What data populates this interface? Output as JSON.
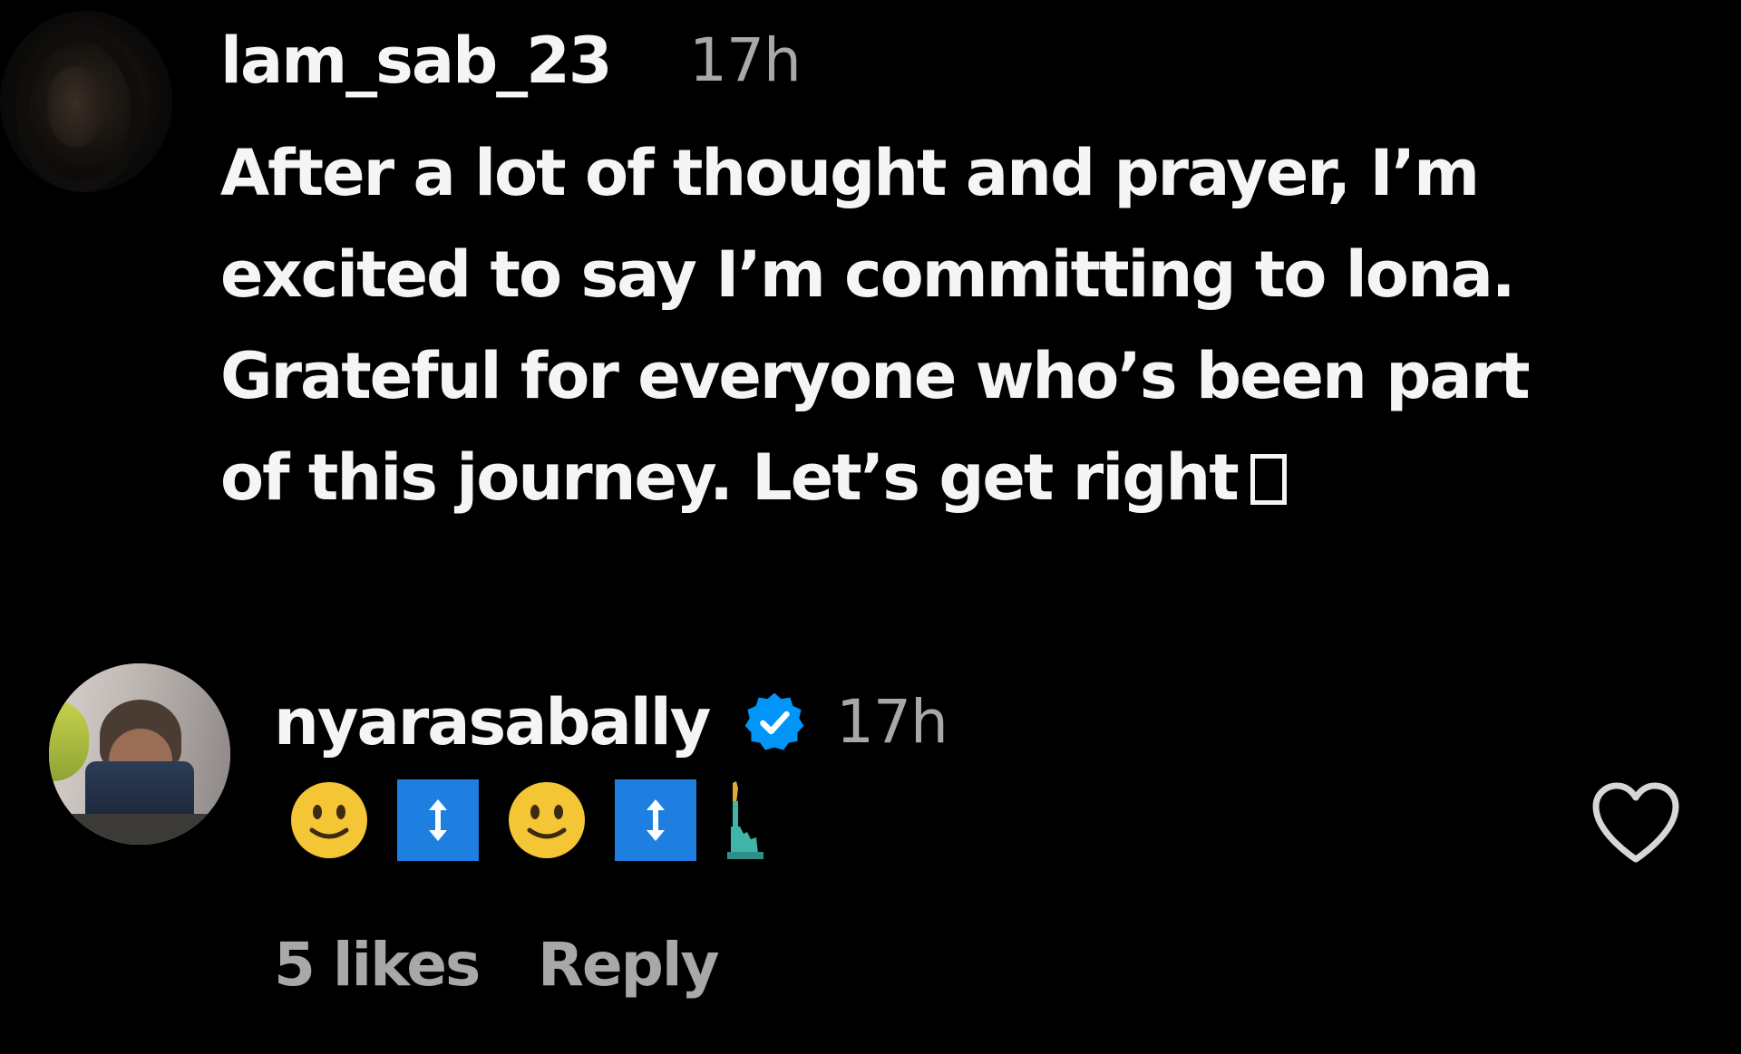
{
  "comments": [
    {
      "username": "lam_sab_23",
      "time": "17h",
      "text_lines": [
        "After a lot of thought and prayer, I’m",
        "excited to say I’m committing to lona.",
        "Grateful for everyone who’s been part",
        "of this journey. Let’s get right"
      ],
      "trailing_glyph": "missing-emoji-box"
    },
    {
      "username": "nyarasabally",
      "verified": true,
      "time": "17h",
      "emojis": [
        "slightly-smiling-face",
        "up-down-arrow",
        "slightly-smiling-face",
        "up-down-arrow",
        "statue-of-liberty"
      ],
      "likes": "5 likes",
      "reply_label": "Reply",
      "liked": false
    }
  ],
  "icons": {
    "verified": "verified-badge-icon",
    "like": "heart-outline-icon"
  },
  "colors": {
    "background": "#000000",
    "primary_text": "#f5f5f5",
    "secondary_text": "#a8a8a8",
    "verified_blue": "#0095f6",
    "emoji_yellow": "#f4c534",
    "arrow_blue": "#1f7fe0",
    "liberty_teal": "#3fb5a8"
  }
}
